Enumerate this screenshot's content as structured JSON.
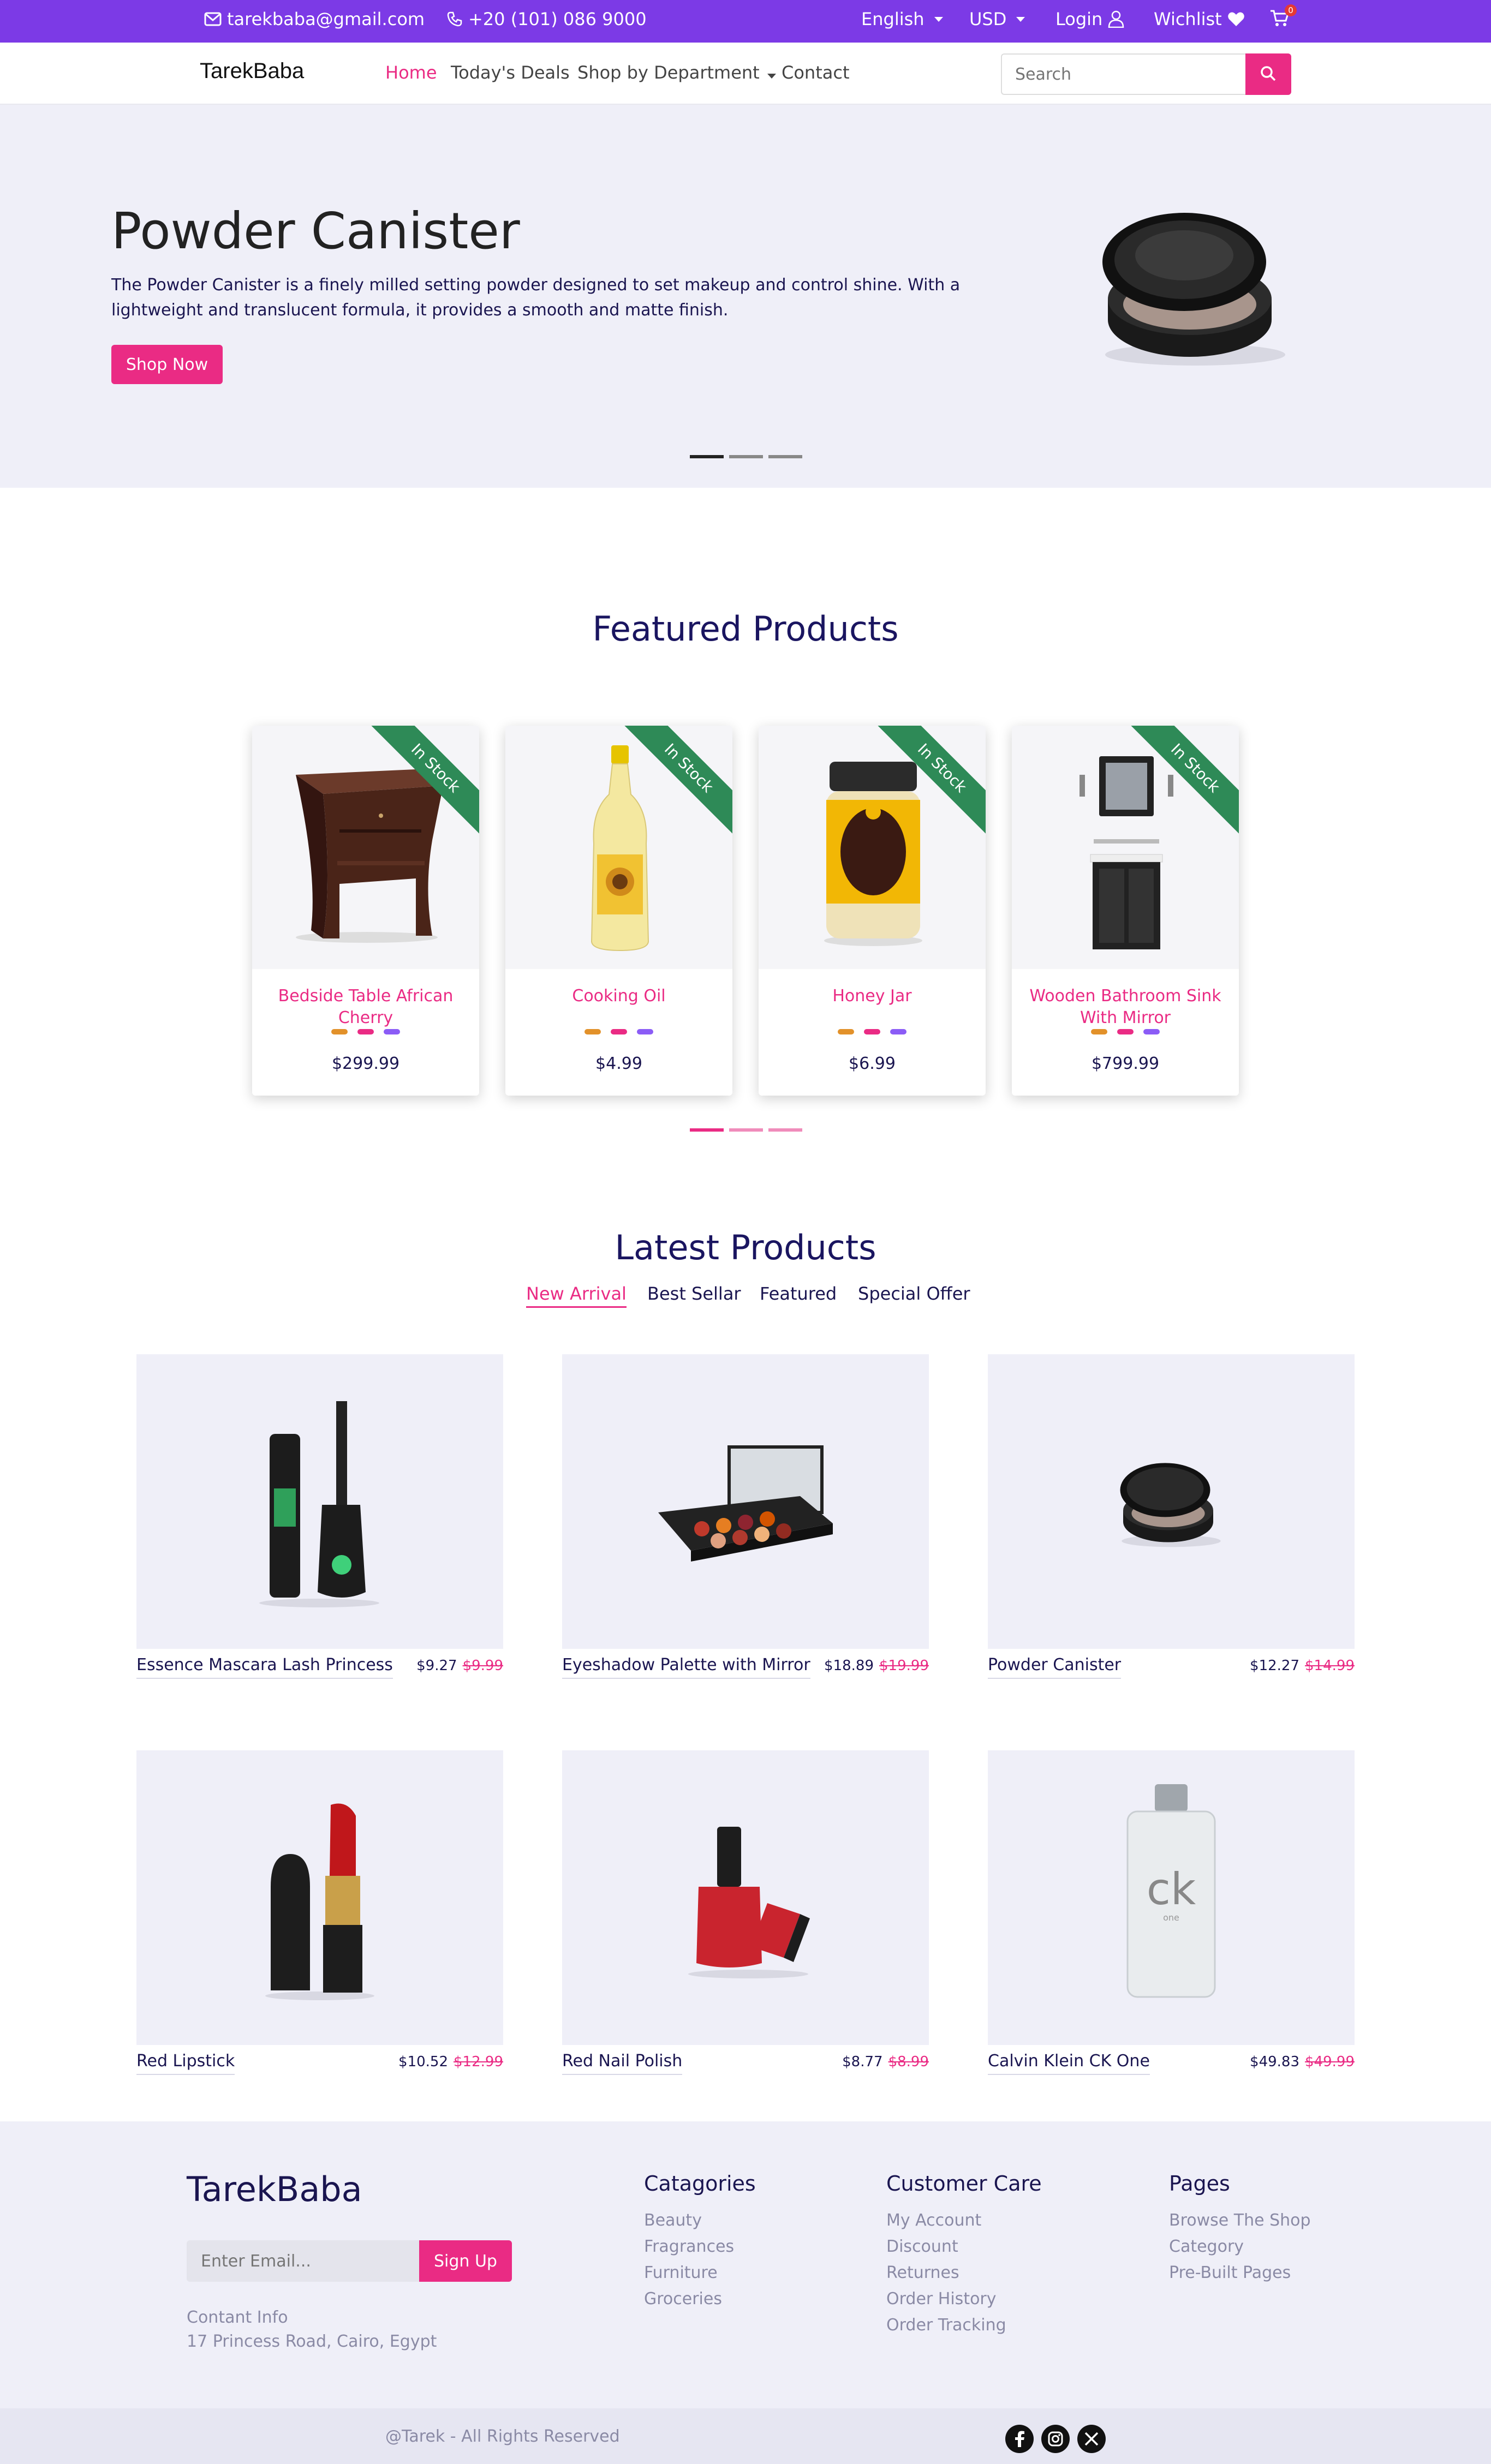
{
  "topbar": {
    "email": "tarekbaba@gmail.com",
    "phone": "+20 (101) 086 9000",
    "language": "English",
    "currency": "USD",
    "login": "Login",
    "wishlist": "Wichlist",
    "cart_count": "0"
  },
  "navbar": {
    "brand": "TarekBaba",
    "links": [
      "Home",
      "Today's Deals",
      "Shop by Department",
      "Contact"
    ],
    "search_placeholder": "Search"
  },
  "hero": {
    "title": "Powder Canister",
    "description": "The Powder Canister is a finely milled setting powder designed to set makeup and control shine. With a lightweight and translucent formula, it provides a smooth and matte finish.",
    "button": "Shop Now",
    "slides": 3,
    "active_slide": 1
  },
  "featured": {
    "title": "Featured Products",
    "badge": "In Stock",
    "products": [
      {
        "name": "Bedside Table African Cherry",
        "price": "$299.99"
      },
      {
        "name": "Cooking Oil",
        "price": "$4.99"
      },
      {
        "name": "Honey Jar",
        "price": "$6.99"
      },
      {
        "name": "Wooden Bathroom Sink With Mirror",
        "price": "$799.99"
      }
    ],
    "color_swatches": [
      "#e2912a",
      "#ea2b84",
      "#8b5cf6"
    ]
  },
  "latest": {
    "title": "Latest Products",
    "tabs": [
      "New Arrival",
      "Best Sellar",
      "Featured",
      "Special Offer"
    ],
    "active_tab": "New Arrival",
    "products": [
      {
        "name": "Essence Mascara Lash Princess",
        "price": "$9.27",
        "old_price": "$9.99"
      },
      {
        "name": "Eyeshadow Palette with Mirror",
        "price": "$18.89",
        "old_price": "$19.99"
      },
      {
        "name": "Powder Canister",
        "price": "$12.27",
        "old_price": "$14.99"
      },
      {
        "name": "Red Lipstick",
        "price": "$10.52",
        "old_price": "$12.99"
      },
      {
        "name": "Red Nail Polish",
        "price": "$8.77",
        "old_price": "$8.99"
      },
      {
        "name": "Calvin Klein CK One",
        "price": "$49.83",
        "old_price": "$49.99"
      }
    ]
  },
  "footer": {
    "brand": "TarekBaba",
    "email_placeholder": "Enter Email...",
    "signup": "Sign Up",
    "contact_label": "Contant Info",
    "address": "17 Princess Road, Cairo, Egypt",
    "columns": [
      {
        "title": "Catagories",
        "links": [
          "Beauty",
          "Fragrances",
          "Furniture",
          "Groceries"
        ]
      },
      {
        "title": "Customer Care",
        "links": [
          "My Account",
          "Discount",
          "Returnes",
          "Order History",
          "Order Tracking"
        ]
      },
      {
        "title": "Pages",
        "links": [
          "Browse The Shop",
          "Category",
          "Pre-Built Pages"
        ]
      }
    ],
    "copyright": "@Tarek - All Rights Reserved",
    "social": [
      "facebook-icon",
      "instagram-icon",
      "x-icon"
    ]
  },
  "colors": {
    "accent": "#ea2b84",
    "topbar": "#7c3ae6",
    "navy": "#1a1550",
    "stock": "#2e8a57"
  }
}
